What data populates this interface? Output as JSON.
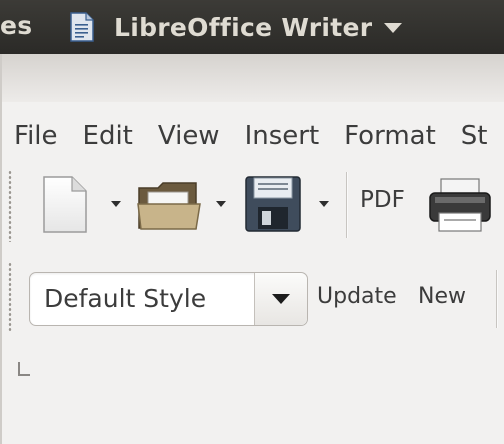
{
  "panel": {
    "previous_text": "es",
    "app_title": "LibreOffice Writer"
  },
  "menubar": {
    "items": [
      "File",
      "Edit",
      "View",
      "Insert",
      "Format",
      "St"
    ]
  },
  "toolbar": {
    "pdf_label": "PDF",
    "icons": [
      "new-document-icon",
      "open-folder-icon",
      "save-floppy-icon",
      "printer-icon"
    ]
  },
  "formatting": {
    "style_value": "Default Style",
    "update_label": "Update",
    "new_label": "New"
  },
  "colors": {
    "panel_bg": "#3c3b37",
    "panel_text": "#dfdbd2",
    "window_bg": "#f2f1f0"
  }
}
